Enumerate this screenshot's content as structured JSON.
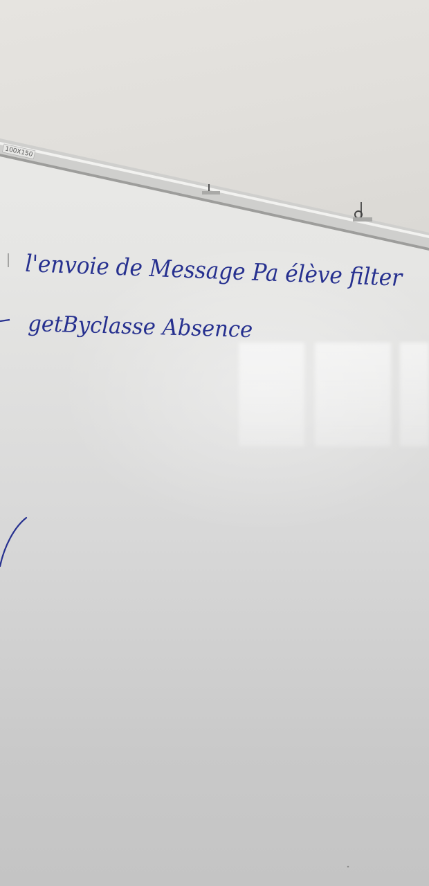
{
  "board": {
    "size_label": "100X150",
    "ink_color": "#26308f",
    "lines": [
      {
        "text": "l'envoie de Message Pa élève filter"
      },
      {
        "text": "getByclasse Absence"
      }
    ]
  }
}
